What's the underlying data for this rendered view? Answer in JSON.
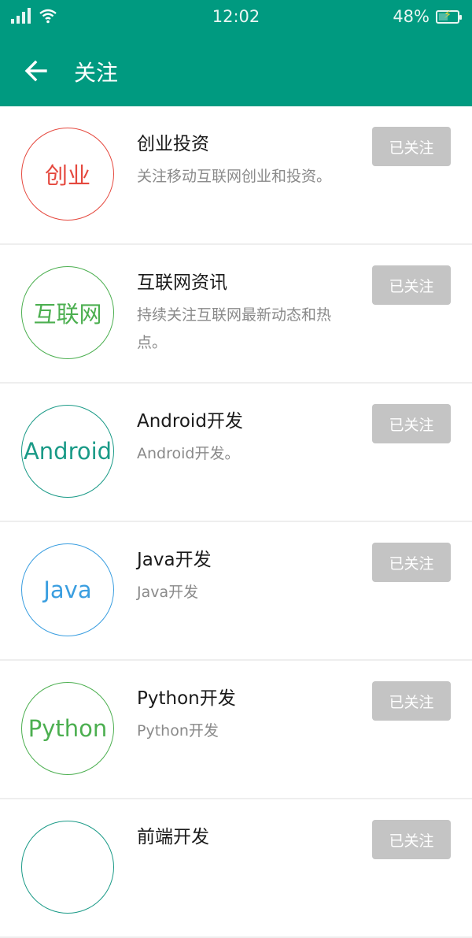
{
  "status_bar": {
    "time": "12:02",
    "battery": "48%",
    "battery_level": 0.48
  },
  "app_bar": {
    "title": "关注",
    "back_icon": "arrow-left-icon"
  },
  "colors": {
    "primary": "#009a80",
    "button": "#c4c4c4"
  },
  "topics": [
    {
      "logo_text": "创业",
      "logo_color": "#e5483e",
      "name": "创业投资",
      "desc": "关注移动互联网创业和投资。",
      "button": "已关注"
    },
    {
      "logo_text": "互联网",
      "logo_color": "#4caf50",
      "name": "互联网资讯",
      "desc": "持续关注互联网最新动态和热点。",
      "button": "已关注"
    },
    {
      "logo_text": "Android",
      "logo_color": "#1a9a87",
      "name": "Android开发",
      "desc": "Android开发。",
      "button": "已关注"
    },
    {
      "logo_text": "Java",
      "logo_color": "#3a9ee0",
      "name": "Java开发",
      "desc": "Java开发",
      "button": "已关注"
    },
    {
      "logo_text": "Python",
      "logo_color": "#4caf50",
      "name": "Python开发",
      "desc": "Python开发",
      "button": "已关注"
    },
    {
      "logo_text": "",
      "logo_color": "#1a9a87",
      "name": "前端开发",
      "desc": "",
      "button": "已关注"
    }
  ]
}
